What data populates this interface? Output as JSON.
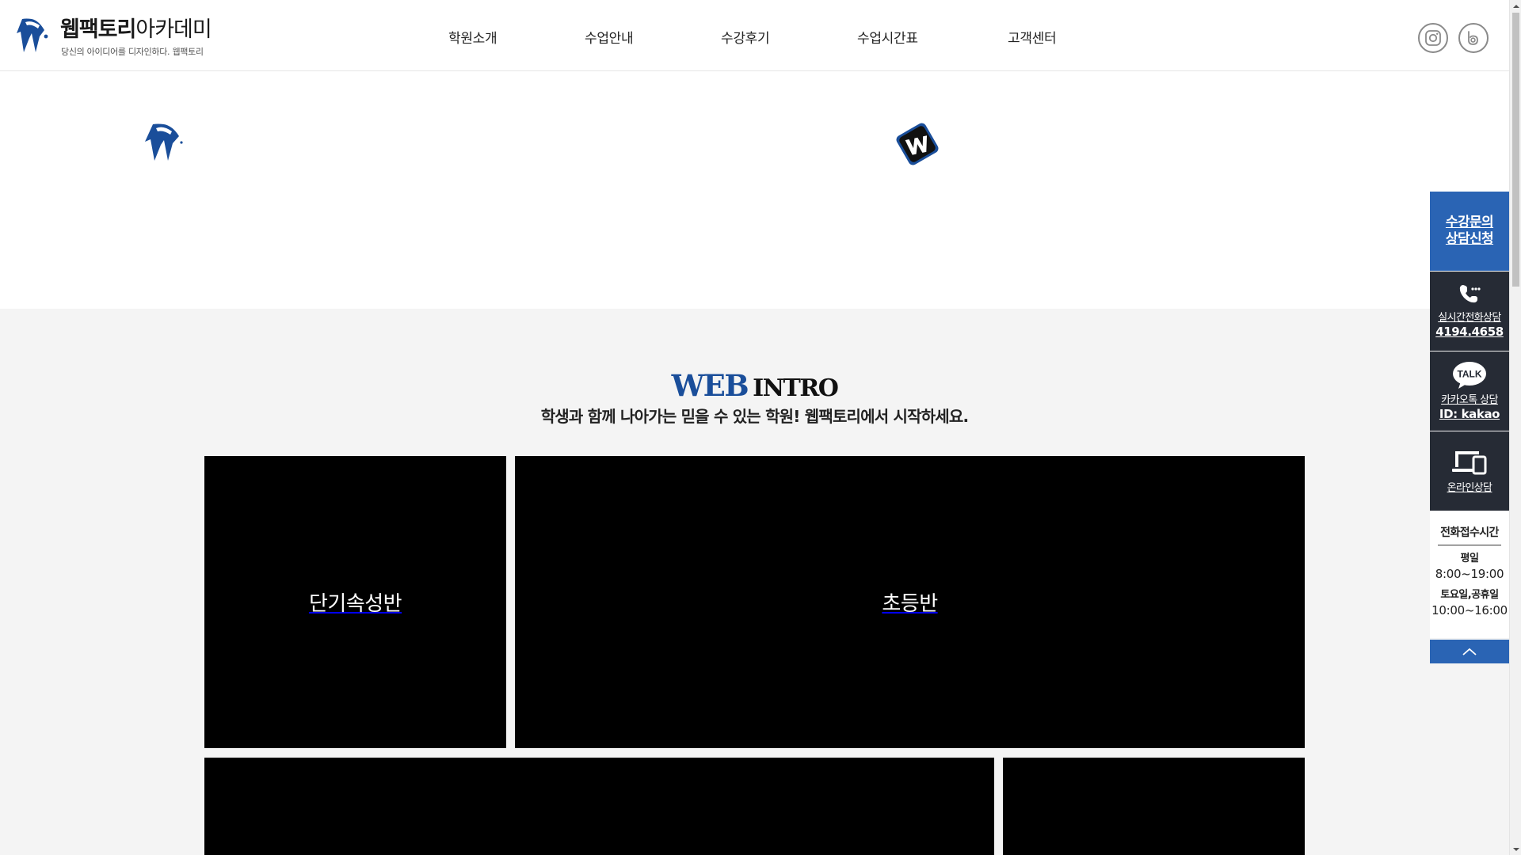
{
  "header": {
    "logo": {
      "title_bold": "웹팩토리",
      "title_light": "아카데미",
      "tagline": "당신의 아이디어를 디자인하다. 웹팩토리"
    },
    "nav": [
      {
        "label": "학원소개"
      },
      {
        "label": "수업안내"
      },
      {
        "label": "수강후기"
      },
      {
        "label": "수업시간표"
      },
      {
        "label": "고객센터"
      }
    ],
    "sns": [
      {
        "icon": "instagram-icon"
      },
      {
        "icon": "blog-icon"
      }
    ]
  },
  "intro": {
    "title_accent": "WEB",
    "title_rest": "INTRO",
    "subtitle": "학생과 함께 나아가는 믿을 수 있는 학원! 웹팩토리에서 시작하세요.",
    "cards": [
      {
        "label": "단기속성반"
      },
      {
        "label": "초등반"
      },
      {
        "label": ""
      },
      {
        "label": ""
      }
    ]
  },
  "quick_menu": {
    "inquiry": {
      "line1": "수강문의",
      "line2": "상담신청"
    },
    "phone": {
      "icon": "phone-icon",
      "label": "실시간전화상담",
      "number": "4194.4658"
    },
    "kakao": {
      "icon": "kakao-talk-icon",
      "badge": "TALK",
      "label": "카카오톡 상담",
      "id": "ID: kakao"
    },
    "online": {
      "icon": "devices-icon",
      "label": "온라인상담"
    },
    "hours": {
      "title": "전화접수시간",
      "weekday_label": "평일",
      "weekday_time": "8:00~19:00",
      "weekend_label": "토요일,공휴일",
      "weekend_time": "10:00~16:00"
    },
    "top": {
      "icon": "chevron-up-icon"
    }
  },
  "colors": {
    "brand_blue": "#1a4e9a",
    "quick_blue": "#2a64b4",
    "quick_dark": "#262b35",
    "section_bg": "#f4f4f4"
  }
}
